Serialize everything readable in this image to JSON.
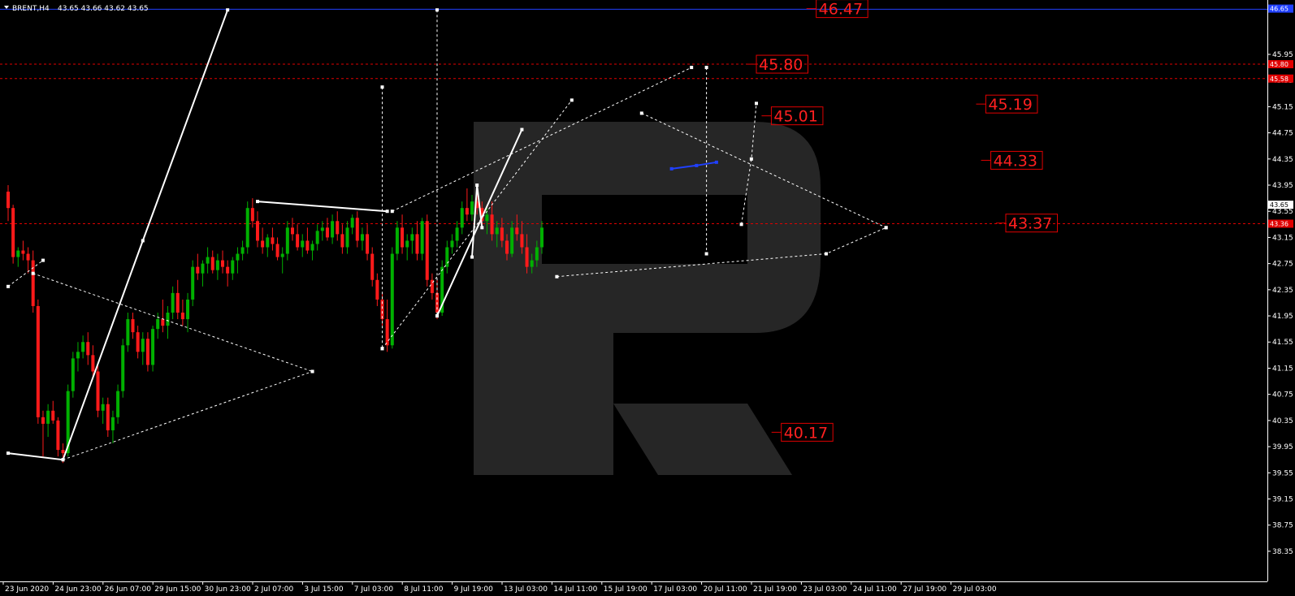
{
  "header": {
    "symbol": "BRENT,H4",
    "ohlc": "43.65 43.66 43.62 43.65"
  },
  "colors": {
    "background": "#000000",
    "bull": "#00b000",
    "bear": "#ff1a1a",
    "level": "#e00000",
    "pattern": "#ffffff",
    "blue_line": "#2040ff",
    "watermark": "#262626"
  },
  "chart_data": {
    "type": "candlestick",
    "title": "",
    "ylim": [
      38.15,
      46.67
    ],
    "y_ticks": [
      "46.65",
      "45.95",
      "45.55",
      "45.15",
      "44.75",
      "44.35",
      "43.95",
      "43.55",
      "43.15",
      "42.75",
      "42.35",
      "41.95",
      "41.55",
      "41.15",
      "40.75",
      "40.35",
      "39.95",
      "39.55",
      "39.15",
      "38.75",
      "38.35"
    ],
    "y_tick_values": [
      46.65,
      45.95,
      45.55,
      45.15,
      44.75,
      44.35,
      43.95,
      43.55,
      43.15,
      42.75,
      42.35,
      41.95,
      41.55,
      41.15,
      40.75,
      40.35,
      39.95,
      39.55,
      39.15,
      38.75,
      38.35
    ],
    "x_ticks": [
      "23 Jun 2020",
      "24 Jun 23:00",
      "26 Jun 07:00",
      "29 Jun 15:00",
      "30 Jun 23:00",
      "2 Jul 07:00",
      "3 Jul 15:00",
      "7 Jul 03:00",
      "8 Jul 11:00",
      "9 Jul 19:00",
      "13 Jul 03:00",
      "14 Jul 11:00",
      "15 Jul 19:00",
      "17 Jul 03:00",
      "20 Jul 11:00",
      "21 Jul 19:00",
      "23 Jul 03:00",
      "24 Jul 11:00",
      "27 Jul 19:00",
      "29 Jul 03:00"
    ],
    "x_tick_index": [
      0,
      10,
      20,
      30,
      40,
      50,
      60,
      70,
      80,
      90,
      100,
      110,
      120,
      130,
      140,
      150,
      160,
      170,
      180,
      190
    ],
    "current_price": "43.65",
    "price_tags": [
      {
        "value": 46.65,
        "label": "46.65",
        "bg": "#2040ff"
      },
      {
        "value": 45.8,
        "label": "45.80",
        "bg": "#e00000"
      },
      {
        "value": 45.58,
        "label": "45.58",
        "bg": "#e00000"
      },
      {
        "value": 43.65,
        "label": "43.65",
        "bg": "#ffffff"
      },
      {
        "value": 43.36,
        "label": "43.36",
        "bg": "#e00000"
      }
    ],
    "levels": [
      {
        "value": 45.8,
        "style": "dashed"
      },
      {
        "value": 45.58,
        "style": "dashed"
      },
      {
        "value": 43.36,
        "style": "dashed"
      }
    ],
    "top_line": 46.64,
    "level_labels": [
      {
        "label": "46.47",
        "value": 46.65,
        "i": 162
      },
      {
        "label": "45.80",
        "value": 45.8,
        "i": 150
      },
      {
        "label": "45.01",
        "value": 45.01,
        "i": 153
      },
      {
        "label": "45.19",
        "value": 45.19,
        "i": 196
      },
      {
        "label": "44.33",
        "value": 44.33,
        "i": 197
      },
      {
        "label": "43.37",
        "value": 43.37,
        "i": 200
      },
      {
        "label": "40.17",
        "value": 40.17,
        "i": 155
      }
    ],
    "candles": [
      {
        "o": 43.85,
        "h": 43.95,
        "l": 43.4,
        "c": 43.6
      },
      {
        "o": 43.6,
        "h": 43.65,
        "l": 42.75,
        "c": 42.85
      },
      {
        "o": 42.85,
        "h": 43.0,
        "l": 42.7,
        "c": 42.95
      },
      {
        "o": 42.95,
        "h": 43.1,
        "l": 42.8,
        "c": 42.9
      },
      {
        "o": 42.9,
        "h": 43.0,
        "l": 42.6,
        "c": 42.8
      },
      {
        "o": 42.8,
        "h": 42.95,
        "l": 42.0,
        "c": 42.1
      },
      {
        "o": 42.1,
        "h": 42.2,
        "l": 40.3,
        "c": 40.4
      },
      {
        "o": 40.4,
        "h": 40.5,
        "l": 39.8,
        "c": 40.3
      },
      {
        "o": 40.3,
        "h": 40.6,
        "l": 40.1,
        "c": 40.5
      },
      {
        "o": 40.5,
        "h": 40.65,
        "l": 40.3,
        "c": 40.35
      },
      {
        "o": 40.35,
        "h": 40.4,
        "l": 39.8,
        "c": 39.9
      },
      {
        "o": 39.9,
        "h": 40.0,
        "l": 39.7,
        "c": 39.85
      },
      {
        "o": 39.85,
        "h": 40.9,
        "l": 39.8,
        "c": 40.8
      },
      {
        "o": 40.8,
        "h": 41.4,
        "l": 40.7,
        "c": 41.3
      },
      {
        "o": 41.3,
        "h": 41.55,
        "l": 41.1,
        "c": 41.4
      },
      {
        "o": 41.4,
        "h": 41.65,
        "l": 41.3,
        "c": 41.55
      },
      {
        "o": 41.55,
        "h": 41.7,
        "l": 41.2,
        "c": 41.35
      },
      {
        "o": 41.35,
        "h": 41.5,
        "l": 41.0,
        "c": 41.1
      },
      {
        "o": 41.1,
        "h": 41.2,
        "l": 40.4,
        "c": 40.5
      },
      {
        "o": 40.5,
        "h": 40.7,
        "l": 40.3,
        "c": 40.6
      },
      {
        "o": 40.6,
        "h": 40.7,
        "l": 40.1,
        "c": 40.2
      },
      {
        "o": 40.2,
        "h": 40.5,
        "l": 40.0,
        "c": 40.4
      },
      {
        "o": 40.4,
        "h": 40.9,
        "l": 40.3,
        "c": 40.8
      },
      {
        "o": 40.8,
        "h": 41.6,
        "l": 40.7,
        "c": 41.5
      },
      {
        "o": 41.5,
        "h": 42.0,
        "l": 41.4,
        "c": 41.9
      },
      {
        "o": 41.9,
        "h": 42.0,
        "l": 41.6,
        "c": 41.7
      },
      {
        "o": 41.7,
        "h": 41.8,
        "l": 41.3,
        "c": 41.4
      },
      {
        "o": 41.4,
        "h": 41.7,
        "l": 41.2,
        "c": 41.6
      },
      {
        "o": 41.6,
        "h": 41.7,
        "l": 41.1,
        "c": 41.2
      },
      {
        "o": 41.2,
        "h": 41.8,
        "l": 41.1,
        "c": 41.75
      },
      {
        "o": 41.75,
        "h": 42.0,
        "l": 41.6,
        "c": 41.9
      },
      {
        "o": 41.9,
        "h": 42.2,
        "l": 41.7,
        "c": 41.8
      },
      {
        "o": 41.8,
        "h": 42.1,
        "l": 41.6,
        "c": 42.0
      },
      {
        "o": 42.0,
        "h": 42.4,
        "l": 41.9,
        "c": 42.3
      },
      {
        "o": 42.3,
        "h": 42.5,
        "l": 41.9,
        "c": 42.0
      },
      {
        "o": 42.0,
        "h": 42.2,
        "l": 41.8,
        "c": 41.9
      },
      {
        "o": 41.9,
        "h": 42.3,
        "l": 41.7,
        "c": 42.2
      },
      {
        "o": 42.2,
        "h": 42.8,
        "l": 42.1,
        "c": 42.7
      },
      {
        "o": 42.7,
        "h": 42.9,
        "l": 42.5,
        "c": 42.6
      },
      {
        "o": 42.6,
        "h": 42.8,
        "l": 42.4,
        "c": 42.75
      },
      {
        "o": 42.75,
        "h": 43.0,
        "l": 42.6,
        "c": 42.85
      },
      {
        "o": 42.85,
        "h": 42.95,
        "l": 42.6,
        "c": 42.65
      },
      {
        "o": 42.65,
        "h": 42.9,
        "l": 42.5,
        "c": 42.8
      },
      {
        "o": 42.8,
        "h": 42.95,
        "l": 42.6,
        "c": 42.7
      },
      {
        "o": 42.7,
        "h": 42.8,
        "l": 42.4,
        "c": 42.6
      },
      {
        "o": 42.6,
        "h": 42.85,
        "l": 42.5,
        "c": 42.8
      },
      {
        "o": 42.8,
        "h": 43.0,
        "l": 42.6,
        "c": 42.9
      },
      {
        "o": 42.9,
        "h": 43.1,
        "l": 42.8,
        "c": 43.0
      },
      {
        "o": 43.0,
        "h": 43.7,
        "l": 42.9,
        "c": 43.6
      },
      {
        "o": 43.6,
        "h": 43.75,
        "l": 43.3,
        "c": 43.4
      },
      {
        "o": 43.4,
        "h": 43.55,
        "l": 43.0,
        "c": 43.1
      },
      {
        "o": 43.1,
        "h": 43.3,
        "l": 42.9,
        "c": 43.0
      },
      {
        "o": 43.0,
        "h": 43.2,
        "l": 42.85,
        "c": 43.15
      },
      {
        "o": 43.15,
        "h": 43.3,
        "l": 42.95,
        "c": 43.05
      },
      {
        "o": 43.05,
        "h": 43.15,
        "l": 42.8,
        "c": 42.85
      },
      {
        "o": 42.85,
        "h": 43.0,
        "l": 42.6,
        "c": 42.9
      },
      {
        "o": 42.9,
        "h": 43.4,
        "l": 42.8,
        "c": 43.3
      },
      {
        "o": 43.3,
        "h": 43.45,
        "l": 43.1,
        "c": 43.2
      },
      {
        "o": 43.2,
        "h": 43.35,
        "l": 42.95,
        "c": 43.0
      },
      {
        "o": 43.0,
        "h": 43.2,
        "l": 42.85,
        "c": 43.1
      },
      {
        "o": 43.1,
        "h": 43.3,
        "l": 42.9,
        "c": 42.95
      },
      {
        "o": 42.95,
        "h": 43.1,
        "l": 42.8,
        "c": 43.05
      },
      {
        "o": 43.05,
        "h": 43.35,
        "l": 42.95,
        "c": 43.25
      },
      {
        "o": 43.25,
        "h": 43.4,
        "l": 43.1,
        "c": 43.3
      },
      {
        "o": 43.3,
        "h": 43.45,
        "l": 43.1,
        "c": 43.15
      },
      {
        "o": 43.15,
        "h": 43.5,
        "l": 43.05,
        "c": 43.4
      },
      {
        "o": 43.4,
        "h": 43.55,
        "l": 43.1,
        "c": 43.2
      },
      {
        "o": 43.2,
        "h": 43.35,
        "l": 42.9,
        "c": 43.0
      },
      {
        "o": 43.0,
        "h": 43.4,
        "l": 42.9,
        "c": 43.3
      },
      {
        "o": 43.3,
        "h": 43.5,
        "l": 43.2,
        "c": 43.45
      },
      {
        "o": 43.45,
        "h": 43.55,
        "l": 43.0,
        "c": 43.1
      },
      {
        "o": 43.1,
        "h": 43.3,
        "l": 42.95,
        "c": 43.2
      },
      {
        "o": 43.2,
        "h": 43.35,
        "l": 42.8,
        "c": 42.9
      },
      {
        "o": 42.9,
        "h": 43.0,
        "l": 42.4,
        "c": 42.5
      },
      {
        "o": 42.5,
        "h": 42.6,
        "l": 42.1,
        "c": 42.2
      },
      {
        "o": 42.2,
        "h": 42.3,
        "l": 41.8,
        "c": 41.9
      },
      {
        "o": 41.9,
        "h": 42.2,
        "l": 41.4,
        "c": 41.5
      },
      {
        "o": 41.5,
        "h": 43.0,
        "l": 41.45,
        "c": 42.9
      },
      {
        "o": 42.9,
        "h": 43.4,
        "l": 42.8,
        "c": 43.3
      },
      {
        "o": 43.3,
        "h": 43.5,
        "l": 42.9,
        "c": 43.0
      },
      {
        "o": 43.0,
        "h": 43.2,
        "l": 42.8,
        "c": 43.1
      },
      {
        "o": 43.1,
        "h": 43.3,
        "l": 42.9,
        "c": 43.2
      },
      {
        "o": 43.2,
        "h": 43.4,
        "l": 42.8,
        "c": 42.9
      },
      {
        "o": 42.9,
        "h": 43.45,
        "l": 42.8,
        "c": 43.4
      },
      {
        "o": 43.4,
        "h": 43.5,
        "l": 42.4,
        "c": 42.5
      },
      {
        "o": 42.5,
        "h": 42.6,
        "l": 42.2,
        "c": 42.3
      },
      {
        "o": 42.3,
        "h": 42.5,
        "l": 41.9,
        "c": 42.0
      },
      {
        "o": 42.0,
        "h": 42.8,
        "l": 41.95,
        "c": 42.7
      },
      {
        "o": 42.7,
        "h": 43.1,
        "l": 42.6,
        "c": 43.0
      },
      {
        "o": 43.0,
        "h": 43.2,
        "l": 42.9,
        "c": 43.1
      },
      {
        "o": 43.1,
        "h": 43.4,
        "l": 43.0,
        "c": 43.3
      },
      {
        "o": 43.3,
        "h": 43.7,
        "l": 43.2,
        "c": 43.6
      },
      {
        "o": 43.6,
        "h": 43.9,
        "l": 43.4,
        "c": 43.5
      },
      {
        "o": 43.5,
        "h": 43.8,
        "l": 43.4,
        "c": 43.7
      },
      {
        "o": 43.7,
        "h": 43.85,
        "l": 43.5,
        "c": 43.6
      },
      {
        "o": 43.6,
        "h": 43.7,
        "l": 43.3,
        "c": 43.4
      },
      {
        "o": 43.4,
        "h": 43.6,
        "l": 43.2,
        "c": 43.5
      },
      {
        "o": 43.5,
        "h": 43.7,
        "l": 43.1,
        "c": 43.2
      },
      {
        "o": 43.2,
        "h": 43.4,
        "l": 43.0,
        "c": 43.3
      },
      {
        "o": 43.3,
        "h": 43.45,
        "l": 43.0,
        "c": 43.1
      },
      {
        "o": 43.1,
        "h": 43.2,
        "l": 42.8,
        "c": 42.9
      },
      {
        "o": 42.9,
        "h": 43.4,
        "l": 42.85,
        "c": 43.3
      },
      {
        "o": 43.3,
        "h": 43.5,
        "l": 43.1,
        "c": 43.2
      },
      {
        "o": 43.2,
        "h": 43.4,
        "l": 42.9,
        "c": 43.0
      },
      {
        "o": 43.0,
        "h": 43.2,
        "l": 42.6,
        "c": 42.7
      },
      {
        "o": 42.7,
        "h": 42.9,
        "l": 42.6,
        "c": 42.8
      },
      {
        "o": 42.8,
        "h": 43.1,
        "l": 42.7,
        "c": 43.0
      },
      {
        "o": 43.0,
        "h": 43.4,
        "l": 42.9,
        "c": 43.3
      }
    ],
    "patterns": [
      {
        "name": "wave-line-1",
        "style": "solid",
        "points": [
          [
            0,
            39.85
          ],
          [
            11,
            39.75
          ],
          [
            27,
            43.1
          ],
          [
            44,
            46.63
          ]
        ]
      },
      {
        "name": "triangle-top-left",
        "style": "dashed",
        "points": [
          [
            5,
            42.6
          ],
          [
            61,
            41.1
          ]
        ]
      },
      {
        "name": "triangle-bottom-left",
        "style": "dashed",
        "points": [
          [
            11,
            39.75
          ],
          [
            61,
            41.1
          ]
        ]
      },
      {
        "name": "wedge-left-entry",
        "style": "dashed",
        "points": [
          [
            0,
            42.4
          ],
          [
            7,
            42.8
          ]
        ]
      },
      {
        "name": "range-top-line",
        "style": "solid",
        "points": [
          [
            50,
            43.7
          ],
          [
            76,
            43.55
          ]
        ]
      },
      {
        "name": "drop-projection",
        "style": "dashed",
        "points": [
          [
            75,
            45.45
          ],
          [
            75,
            41.45
          ]
        ]
      },
      {
        "name": "channel-lower",
        "style": "dashed",
        "points": [
          [
            75,
            41.45
          ],
          [
            113,
            45.25
          ]
        ]
      },
      {
        "name": "channel-upper",
        "style": "dashed",
        "points": [
          [
            77,
            43.55
          ],
          [
            137,
            45.75
          ]
        ]
      },
      {
        "name": "impulse-line",
        "style": "solid",
        "points": [
          [
            86,
            41.95
          ],
          [
            103,
            44.8
          ]
        ]
      },
      {
        "name": "vertical-marker",
        "style": "dashed",
        "points": [
          [
            86,
            46.63
          ],
          [
            86,
            41.95
          ]
        ]
      },
      {
        "name": "small-pivot",
        "style": "solid",
        "points": [
          [
            93,
            42.85
          ],
          [
            94,
            43.95
          ],
          [
            95,
            43.3
          ]
        ]
      },
      {
        "name": "right-triangle-lower",
        "style": "dashed",
        "points": [
          [
            110,
            42.55
          ],
          [
            164,
            42.9
          ],
          [
            176,
            43.3
          ]
        ]
      },
      {
        "name": "right-triangle-upper",
        "style": "dashed",
        "points": [
          [
            127,
            45.05
          ],
          [
            176,
            43.3
          ]
        ]
      },
      {
        "name": "spike-vertical",
        "style": "dashed",
        "points": [
          [
            140,
            45.75
          ],
          [
            140,
            42.9
          ]
        ]
      },
      {
        "name": "blue-segment",
        "style": "solid",
        "color": "blue",
        "points": [
          [
            133,
            44.2
          ],
          [
            138,
            44.25
          ],
          [
            142,
            44.3
          ]
        ]
      },
      {
        "name": "forecast-path",
        "style": "dashed",
        "points": [
          [
            147,
            43.35
          ],
          [
            149,
            44.35
          ],
          [
            150,
            45.2
          ]
        ]
      }
    ]
  }
}
